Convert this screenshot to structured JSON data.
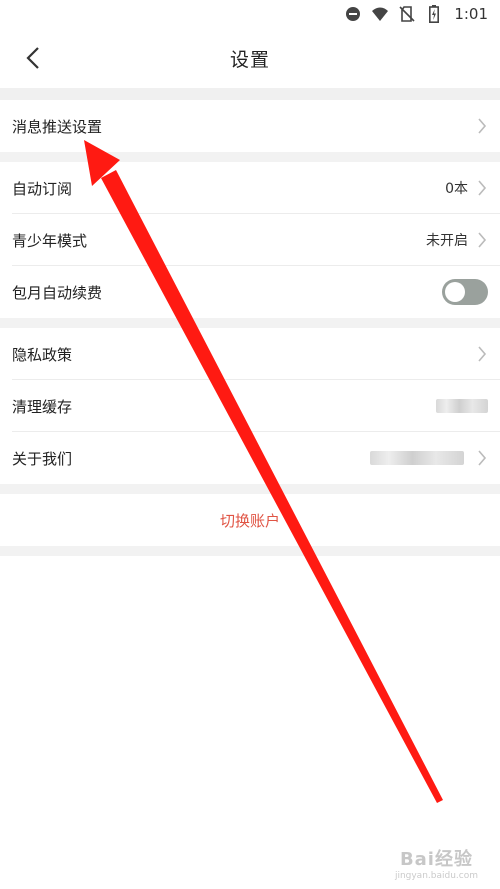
{
  "status_bar": {
    "time": "1:01"
  },
  "header": {
    "title": "设置"
  },
  "settings": {
    "push": {
      "label": "消息推送设置"
    },
    "auto_subscribe": {
      "label": "自动订阅",
      "value": "0本"
    },
    "youth_mode": {
      "label": "青少年模式",
      "value": "未开启"
    },
    "monthly_renew": {
      "label": "包月自动续费",
      "enabled": false
    },
    "privacy": {
      "label": "隐私政策"
    },
    "clear_cache": {
      "label": "清理缓存"
    },
    "about": {
      "label": "关于我们"
    }
  },
  "switch_account": {
    "label": "切换账户",
    "color": "#e05444"
  },
  "annotation": {
    "arrow_color": "#ff1a12"
  },
  "watermark": {
    "main": "Bai经验",
    "sub": "jingyan.baidu.com"
  }
}
